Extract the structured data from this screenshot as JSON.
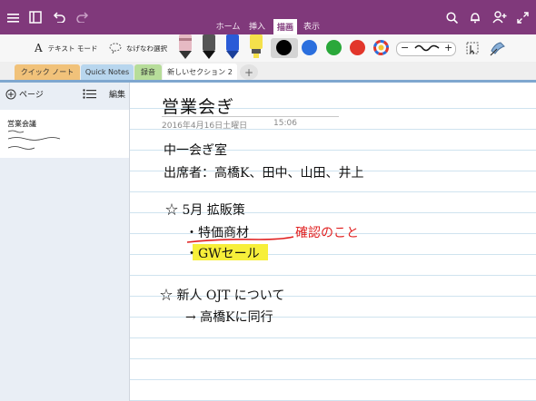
{
  "ribbon": {
    "tabs": [
      "ホーム",
      "挿入",
      "描画",
      "表示"
    ],
    "active_tab": "描画",
    "colors": {
      "ribbon": "#80397b",
      "active_text": "#80397b"
    },
    "icons": [
      "menu-icon",
      "notebooks-icon",
      "undo-icon",
      "redo-icon",
      "search-icon",
      "bell-icon",
      "add-person-icon",
      "expand-icon"
    ]
  },
  "draw_toolbar": {
    "text_mode_label": "テキスト モード",
    "lasso_label": "なげなわ選択",
    "pens": [
      "pen-pink",
      "pen-black",
      "pen-blue",
      "highlighter-yellow"
    ],
    "selected_color": "#000000",
    "colors": [
      "#000000",
      "#2b6fde",
      "#2aa83a",
      "#e2362b",
      "multicolor"
    ]
  },
  "sections": {
    "tabs": [
      {
        "label": "クイック ノート",
        "color": "#f1c27a"
      },
      {
        "label": "Quick Notes",
        "color": "#b8d6ee"
      },
      {
        "label": "録音",
        "color": "#b7dd9a"
      },
      {
        "label": "新しいセクション 2",
        "color": "#ffffff"
      }
    ],
    "active": "新しいセクション 2",
    "add_label": "+"
  },
  "left_pane": {
    "add_page_label": "ページ",
    "edit_label": "編集",
    "page_thumb_title": "営業会議"
  },
  "note": {
    "title": "営業会ぎ",
    "date": "2016年4月16日土曜日",
    "time": "15:06",
    "lines": [
      "中一会ぎ室",
      "出席者：高橋K、田中、山田、井上",
      "☆ 5月 拡販策",
      "・特価商材",
      "・GWセール",
      "☆ 新人 OJT について",
      "→ 高橋Kに同行"
    ],
    "annotation": "確認のこと",
    "annotation_color": "#e02020",
    "highlight_color": "#f7ef3a"
  }
}
